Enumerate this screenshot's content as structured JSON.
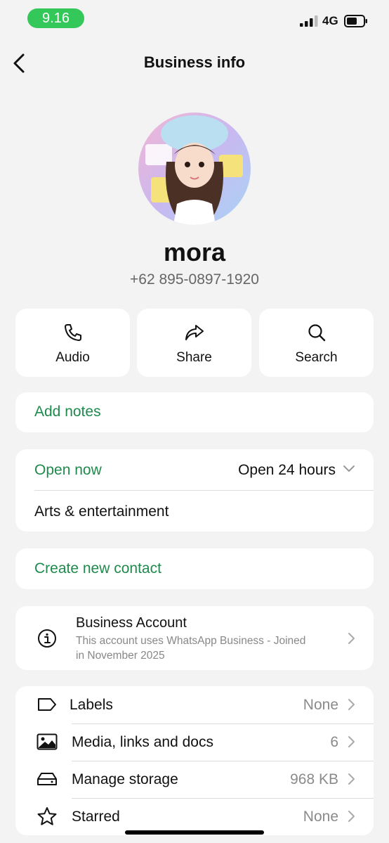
{
  "status_bar": {
    "time": "9.16",
    "network": "4G"
  },
  "nav": {
    "title": "Business info"
  },
  "profile": {
    "name": "mora",
    "phone": "+62 895-0897-1920"
  },
  "actions": [
    {
      "label": "Audio",
      "icon": "phone-icon"
    },
    {
      "label": "Share",
      "icon": "share-icon"
    },
    {
      "label": "Search",
      "icon": "search-icon"
    }
  ],
  "notes": {
    "label": "Add notes"
  },
  "hours": {
    "status": "Open now",
    "value": "Open 24 hours",
    "category": "Arts & entertainment"
  },
  "contact": {
    "label": "Create new contact"
  },
  "business_account": {
    "title": "Business Account",
    "line1": "This account uses WhatsApp Business - Joined",
    "line2": "in November 2025"
  },
  "menu": {
    "labels": {
      "label": "Labels",
      "value": "None"
    },
    "media": {
      "label": "Media, links and docs",
      "value": "6"
    },
    "storage": {
      "label": "Manage storage",
      "value": "968 KB"
    },
    "starred": {
      "label": "Starred",
      "value": "None"
    }
  },
  "colors": {
    "accent_green": "#1f8a4c",
    "status_green": "#34c759",
    "background": "#f3f3f3"
  }
}
